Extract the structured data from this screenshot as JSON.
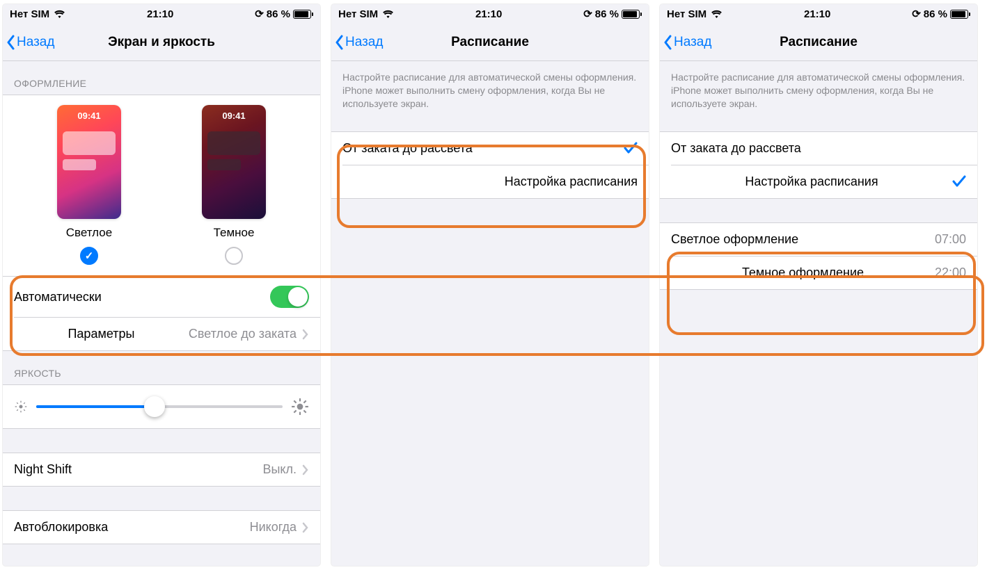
{
  "status": {
    "carrier": "Нет SIM",
    "time": "21:10",
    "battery": "86 %"
  },
  "nav": {
    "back": "Назад"
  },
  "screen1": {
    "title": "Экран и яркость",
    "appearance_header": "ОФОРМЛЕНИЕ",
    "light": "Светлое",
    "dark": "Темное",
    "thumb_time": "09:41",
    "auto": "Автоматически",
    "options_label": "Параметры",
    "options_value": "Светлое до заката",
    "brightness_header": "ЯРКОСТЬ",
    "nightshift_label": "Night Shift",
    "nightshift_value": "Выкл.",
    "autolock_label": "Автоблокировка",
    "autolock_value": "Никогда"
  },
  "screen2": {
    "title": "Расписание",
    "desc": "Настройте расписание для автоматической смены оформления. iPhone может выполнить смену оформления, когда Вы не используете экран.",
    "opt1": "От заката до рассвета",
    "opt2": "Настройка расписания"
  },
  "screen3": {
    "title": "Расписание",
    "desc": "Настройте расписание для автоматической смены оформления. iPhone может выполнить смену оформления, когда Вы не используете экран.",
    "opt1": "От заката до рассвета",
    "opt2": "Настройка расписания",
    "light_label": "Светлое оформление",
    "light_time": "07:00",
    "dark_label": "Темное оформление",
    "dark_time": "22:00"
  }
}
